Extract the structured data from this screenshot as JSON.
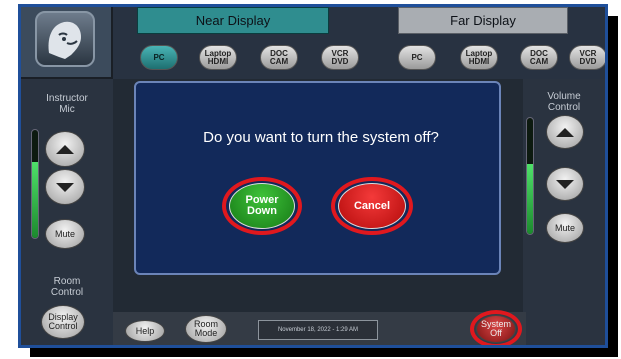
{
  "header": {
    "near_display": "Near Display",
    "far_display": "Far Display"
  },
  "sources": {
    "near": [
      "PC",
      "Laptop\nHDMI",
      "DOC\nCAM",
      "VCR\nDVD"
    ],
    "far": [
      "PC",
      "Laptop\nHDMI",
      "DOC\nCAM",
      "VCR\nDVD"
    ],
    "active_near": "PC"
  },
  "left_panel": {
    "title": "Instructor\nMic",
    "mute": "Mute",
    "room_control": "Room\nControl",
    "display_control": "Display\nControl"
  },
  "right_panel": {
    "title": "Volume\nControl",
    "mute": "Mute"
  },
  "dialog": {
    "message": "Do you want to turn the system off?",
    "power_down": "Power\nDown",
    "cancel": "Cancel"
  },
  "bottom_bar": {
    "help": "Help",
    "room_mode": "Room\nMode",
    "datetime": "November 18, 2022  -  1:29 AM",
    "system_off": "System\nOff"
  },
  "colors": {
    "accent_teal": "#2f8d8f",
    "highlight_red": "#e0181e",
    "dialog_blue": "#12295a"
  }
}
